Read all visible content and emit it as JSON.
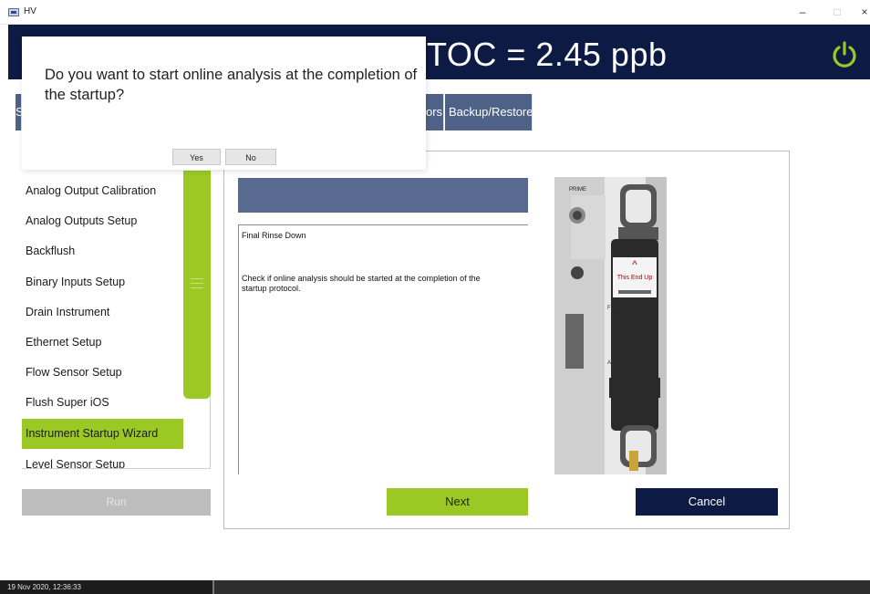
{
  "window": {
    "title": "HV",
    "minimize": "–",
    "maximize": "□",
    "close": "×"
  },
  "header": {
    "toc_reading": "TOC = 2.45 ppb"
  },
  "tabs": [
    {
      "label": "S"
    },
    {
      "label": "ors"
    },
    {
      "label": "Backup/Restore"
    }
  ],
  "dialog": {
    "message": "Do you want to start online analysis at the completion of the startup?",
    "yes_label": "Yes",
    "no_label": "No"
  },
  "sidebar": {
    "items": [
      {
        "label": "Analog Output Calibration"
      },
      {
        "label": "Analog Outputs Setup"
      },
      {
        "label": "Backflush"
      },
      {
        "label": "Binary Inputs Setup"
      },
      {
        "label": "Drain Instrument"
      },
      {
        "label": "Ethernet Setup"
      },
      {
        "label": "Flow Sensor Setup"
      },
      {
        "label": "Flush Super iOS"
      },
      {
        "label": "Instrument Startup Wizard",
        "selected": true
      },
      {
        "label": "Level Sensor Setup"
      }
    ],
    "bottom_button": "Run"
  },
  "wizard": {
    "step_title": "Final Rinse Down",
    "description_line1": "Check if online analysis should be started at the completion of the",
    "description_line2": "startup protocol."
  },
  "photo": {
    "labels": {
      "prime": "PRIME",
      "this_end_up": "This End Up",
      "full": "FULL",
      "add": "ADD"
    }
  },
  "actions": {
    "next_label": "Next",
    "cancel_label": "Cancel"
  },
  "statusbar": {
    "datetime": "19 Nov 2020, 12:36:33"
  },
  "colors": {
    "navy": "#0d1a44",
    "accent_green": "#9cc825",
    "tab_blue": "#4e6287",
    "band_blue": "#596a91"
  }
}
